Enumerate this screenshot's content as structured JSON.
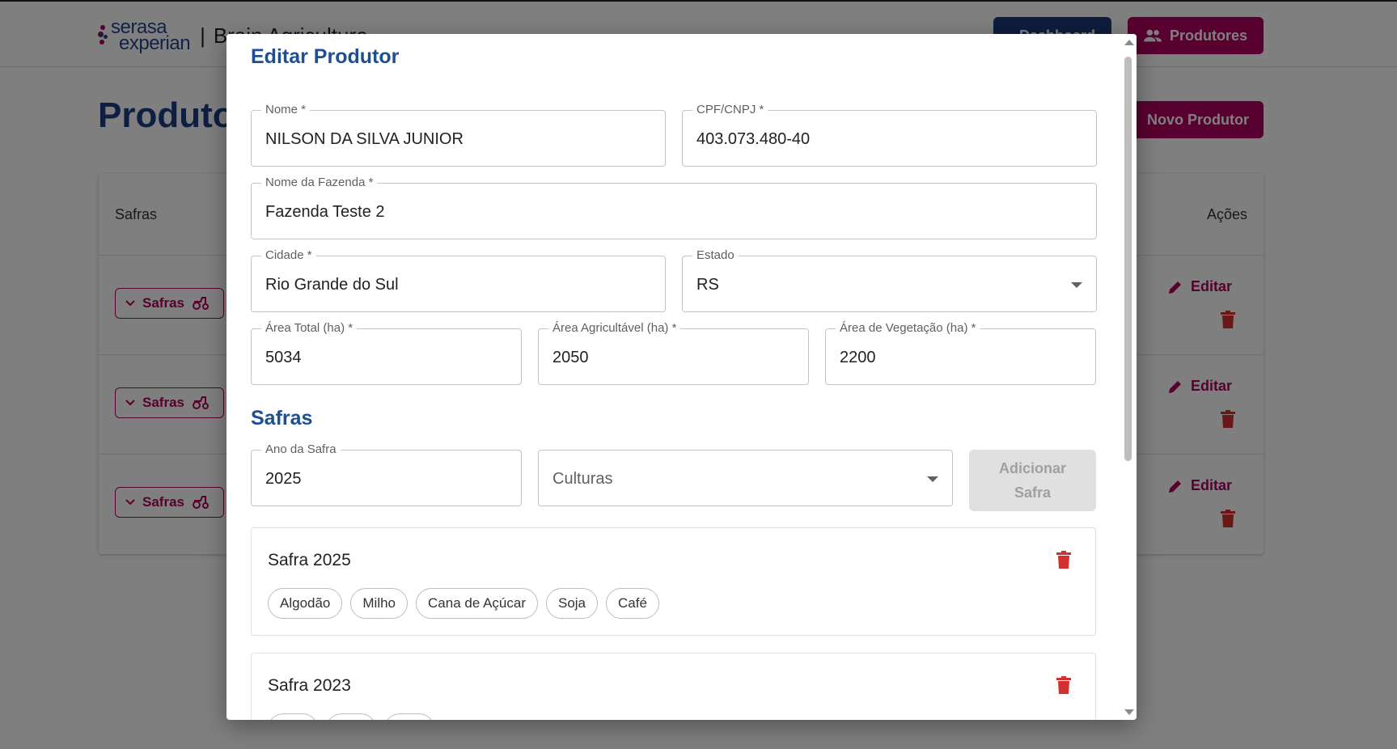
{
  "header": {
    "logo_line1": "serasa",
    "logo_line2": "experian",
    "separator": "|",
    "app_name": "Brain Agriculture",
    "nav": [
      {
        "label": "Dashboard",
        "icon": "dashboard-icon"
      },
      {
        "label": "Produtores",
        "icon": "people-icon"
      }
    ]
  },
  "page": {
    "title": "Produtores",
    "new_button": "Novo Produtor",
    "table": {
      "col_safras": "Safras",
      "col_acoes": "Ações",
      "rows": [
        {
          "safras_label": "Safras",
          "edit_label": "Editar"
        },
        {
          "safras_label": "Safras",
          "edit_label": "Editar"
        },
        {
          "safras_label": "Safras",
          "edit_label": "Editar"
        }
      ]
    }
  },
  "modal": {
    "title": "Editar Produtor",
    "fields": {
      "nome": {
        "label": "Nome *",
        "value": "NILSON DA SILVA JUNIOR"
      },
      "cpf": {
        "label": "CPF/CNPJ *",
        "value": "403.073.480-40"
      },
      "fazenda": {
        "label": "Nome da Fazenda *",
        "value": "Fazenda Teste 2"
      },
      "cidade": {
        "label": "Cidade *",
        "value": "Rio Grande do Sul"
      },
      "estado": {
        "label": "Estado",
        "value": "RS"
      },
      "area_total": {
        "label": "Área Total (ha) *",
        "value": "5034"
      },
      "area_agricultavel": {
        "label": "Área Agricultável (ha) *",
        "value": "2050"
      },
      "area_vegetacao": {
        "label": "Área de Vegetação (ha) *",
        "value": "2200"
      }
    },
    "safras_section": {
      "title": "Safras",
      "ano_label": "Ano da Safra",
      "ano_value": "2025",
      "culturas_placeholder": "Culturas",
      "add_button_line1": "Adicionar",
      "add_button_line2": "Safra"
    },
    "safras": [
      {
        "title": "Safra 2025",
        "culturas": [
          "Algodão",
          "Milho",
          "Cana de Açúcar",
          "Soja",
          "Café"
        ]
      },
      {
        "title": "Safra 2023",
        "culturas": []
      }
    ],
    "colors": {
      "primary": "#1d4f91",
      "accent": "#b1005f",
      "danger": "#d32f2f"
    }
  }
}
